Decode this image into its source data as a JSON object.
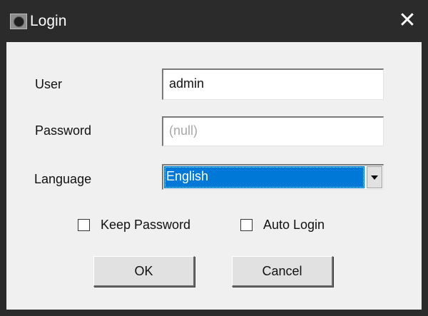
{
  "window": {
    "title": "Login",
    "close_glyph": "✕"
  },
  "form": {
    "user": {
      "label": "User",
      "value": "admin"
    },
    "password": {
      "label": "Password",
      "value": "",
      "placeholder": "(null)"
    },
    "language": {
      "label": "Language",
      "selected": "English"
    },
    "keep_password": {
      "label": "Keep Password",
      "checked": false
    },
    "auto_login": {
      "label": "Auto Login",
      "checked": false
    }
  },
  "buttons": {
    "ok": "OK",
    "cancel": "Cancel"
  },
  "colors": {
    "titlebar": "#2b2b2b",
    "client": "#f0f0f0",
    "selection": "#0078d7"
  },
  "icons": {
    "app": "app-logo-icon",
    "close": "close-icon",
    "dropdown": "chevron-down-icon"
  }
}
